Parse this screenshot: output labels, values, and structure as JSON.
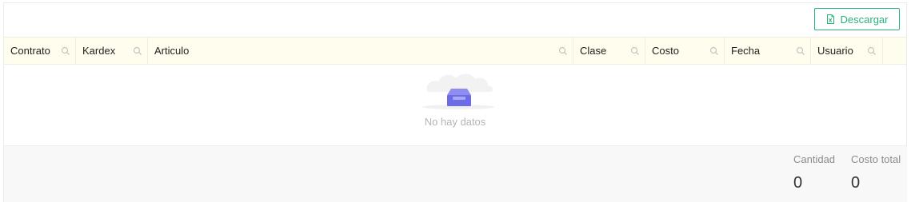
{
  "toolbar": {
    "download_label": "Descargar",
    "download_icon": "excel-file-icon",
    "accent": "#2ab27b"
  },
  "table": {
    "columns": [
      {
        "key": "contrato",
        "label": "Contrato"
      },
      {
        "key": "kardex",
        "label": "Kardex"
      },
      {
        "key": "articulo",
        "label": "Articulo"
      },
      {
        "key": "clase",
        "label": "Clase"
      },
      {
        "key": "costo",
        "label": "Costo"
      },
      {
        "key": "fecha",
        "label": "Fecha"
      },
      {
        "key": "usuario",
        "label": "Usuario"
      }
    ],
    "header_bg": "#fffdee",
    "filter_icon": "search-icon",
    "empty_text": "No hay datos",
    "empty_icon": "empty-box-icon"
  },
  "summary": {
    "cantidad_label": "Cantidad",
    "cantidad_value": "0",
    "costo_total_label": "Costo total",
    "costo_total_value": "0"
  }
}
